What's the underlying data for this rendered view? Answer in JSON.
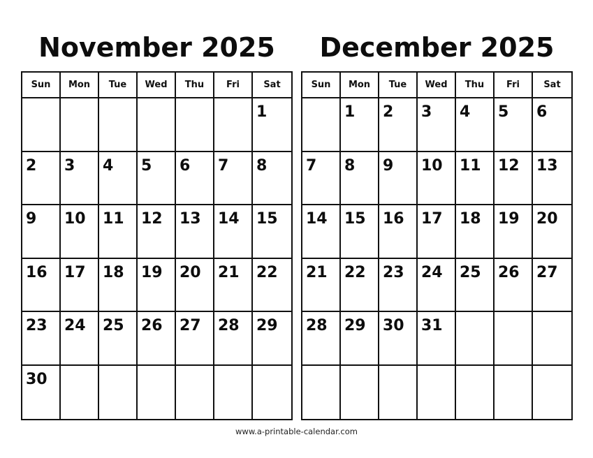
{
  "weekdays": [
    "Sun",
    "Mon",
    "Tue",
    "Wed",
    "Thu",
    "Fri",
    "Sat"
  ],
  "months": [
    {
      "title": "November 2025",
      "weeks": [
        [
          "",
          "",
          "",
          "",
          "",
          "",
          "1"
        ],
        [
          "2",
          "3",
          "4",
          "5",
          "6",
          "7",
          "8"
        ],
        [
          "9",
          "10",
          "11",
          "12",
          "13",
          "14",
          "15"
        ],
        [
          "16",
          "17",
          "18",
          "19",
          "20",
          "21",
          "22"
        ],
        [
          "23",
          "24",
          "25",
          "26",
          "27",
          "28",
          "29"
        ],
        [
          "30",
          "",
          "",
          "",
          "",
          "",
          ""
        ]
      ]
    },
    {
      "title": "December 2025",
      "weeks": [
        [
          "",
          "1",
          "2",
          "3",
          "4",
          "5",
          "6"
        ],
        [
          "7",
          "8",
          "9",
          "10",
          "11",
          "12",
          "13"
        ],
        [
          "14",
          "15",
          "16",
          "17",
          "18",
          "19",
          "20"
        ],
        [
          "21",
          "22",
          "23",
          "24",
          "25",
          "26",
          "27"
        ],
        [
          "28",
          "29",
          "30",
          "31",
          "",
          "",
          ""
        ],
        [
          "",
          "",
          "",
          "",
          "",
          "",
          ""
        ]
      ]
    }
  ],
  "footer": "www.a-printable-calendar.com"
}
